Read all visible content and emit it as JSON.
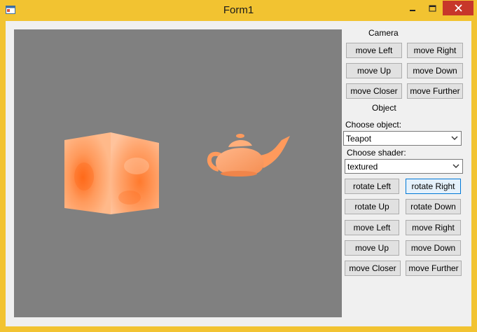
{
  "window": {
    "title": "Form1"
  },
  "titlebar_controls": [
    "minimize-icon",
    "maximize-icon",
    "close-icon"
  ],
  "colors": {
    "frame": "#f2c331",
    "close_button": "#c7372a",
    "viewport": "#808080",
    "object_orange": "#ff9a5c"
  },
  "viewport": {
    "objects": [
      "cube",
      "teapot"
    ]
  },
  "camera": {
    "heading": "Camera",
    "move_left": "move Left",
    "move_right": "move Right",
    "move_up": "move Up",
    "move_down": "move Down",
    "move_closer": "move Closer",
    "move_further": "move Further"
  },
  "object": {
    "heading": "Object",
    "choose_object_label": "Choose object:",
    "object_value": "Teapot",
    "choose_shader_label": "Choose shader:",
    "shader_value": "textured",
    "rotate_left": "rotate Left",
    "rotate_right": "rotate Right",
    "rotate_up": "rotate Up",
    "rotate_down": "rotate Down",
    "move_left": "move Left",
    "move_right": "move Right",
    "move_up": "move Up",
    "move_down": "move Down",
    "move_closer": "move Closer",
    "move_further": "move Further"
  }
}
